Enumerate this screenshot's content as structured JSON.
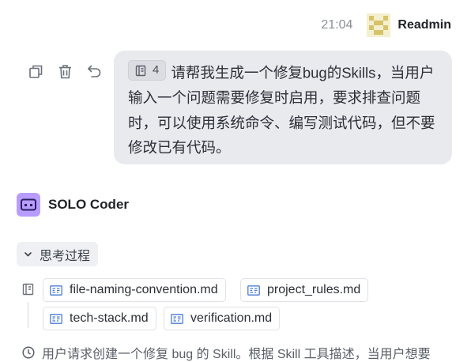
{
  "header": {
    "time": "21:04",
    "username": "Readmin"
  },
  "actions": {
    "icons": [
      "copy-icon",
      "trash-icon",
      "undo-icon"
    ]
  },
  "user_message": {
    "ref_count": "4",
    "text": "请帮我生成一个修复bug的Skills，当用户输入一个问题需要修复时启用，要求排查问题时，可以使用系统命令、编写测试代码，但不要修改已有代码。"
  },
  "agent": {
    "name": "SOLO Coder",
    "thinking_label": "思考过程",
    "files": [
      "file-naming-convention.md",
      "project_rules.md",
      "tech-stack.md",
      "verification.md"
    ],
    "summary_text": "用户请求创建一个修复 bug 的 Skill。根据 Skill 工具描述，当用户想要"
  },
  "colors": {
    "bubble_bg": "#e9eaee",
    "agent_icon": "#b89cff",
    "file_icon": "#4a7bd8"
  }
}
